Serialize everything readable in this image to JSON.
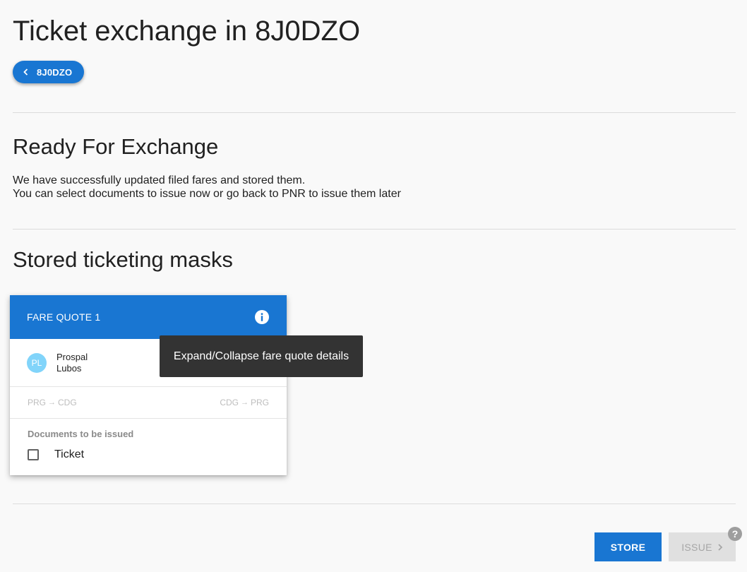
{
  "header": {
    "title": "Ticket exchange in 8J0DZO",
    "back_label": "8J0DZO"
  },
  "ready": {
    "title": "Ready For Exchange",
    "line1": "We have successfully updated filed fares and stored them.",
    "line2": "You can select documents to issue now or go back to PNR to issue them later"
  },
  "masks": {
    "title": "Stored ticketing masks",
    "card": {
      "title": "FARE QUOTE 1",
      "passenger": {
        "initials": "PL",
        "last_name": "Prospal",
        "first_name": "Lubos"
      },
      "routes": [
        {
          "from": "PRG",
          "arrow": "→",
          "to": "CDG"
        },
        {
          "from": "CDG",
          "arrow": "→",
          "to": "PRG"
        }
      ],
      "documents_label": "Documents to be issued",
      "documents": [
        {
          "label": "Ticket",
          "checked": false
        }
      ]
    },
    "tooltip": "Expand/Collapse fare quote details"
  },
  "footer": {
    "store_label": "STORE",
    "issue_label": "ISSUE",
    "help_glyph": "?"
  },
  "colors": {
    "primary": "#1976d2",
    "avatar": "#81d4fa",
    "tooltip_bg": "#333333",
    "disabled_bg": "#e0e0e0"
  },
  "icons": [
    "chevron-left-icon",
    "info-icon",
    "arrow-right-icon",
    "chevron-right-icon",
    "help-icon"
  ]
}
